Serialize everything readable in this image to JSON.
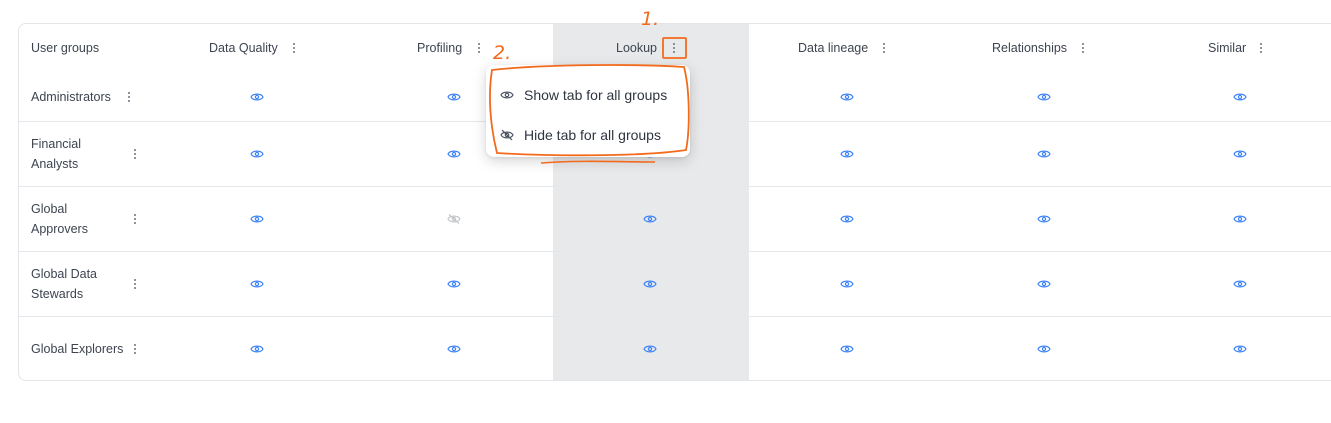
{
  "table": {
    "header": {
      "user_groups": "User groups",
      "columns": [
        "Data Quality",
        "Profiling",
        "Lookup",
        "Data lineage",
        "Relationships",
        "Similar"
      ]
    },
    "rows": [
      {
        "name": "Administrators",
        "visibility": [
          "visible",
          "visible",
          "visible",
          "visible",
          "visible",
          "visible"
        ]
      },
      {
        "name": "Financial Analysts",
        "visibility": [
          "visible",
          "visible",
          "visible",
          "visible",
          "visible",
          "visible"
        ]
      },
      {
        "name": "Global Approvers",
        "visibility": [
          "visible",
          "hidden",
          "visible",
          "visible",
          "visible",
          "visible"
        ]
      },
      {
        "name": "Global Data Stewards",
        "visibility": [
          "visible",
          "visible",
          "visible",
          "visible",
          "visible",
          "visible"
        ]
      },
      {
        "name": "Global Explorers",
        "visibility": [
          "visible",
          "visible",
          "visible",
          "visible",
          "visible",
          "visible"
        ]
      }
    ],
    "highlighted_column": "Lookup"
  },
  "popup_menu": {
    "show_label": "Show tab for all groups",
    "hide_label": "Hide tab for all groups"
  },
  "annotations": {
    "step1": "1.",
    "step2": "2."
  },
  "colors": {
    "eye_visible": "#3b82f6",
    "eye_hidden": "#c4c7cc",
    "annotation": "#f26b1d",
    "highlight_column": "#e8e9eb"
  }
}
